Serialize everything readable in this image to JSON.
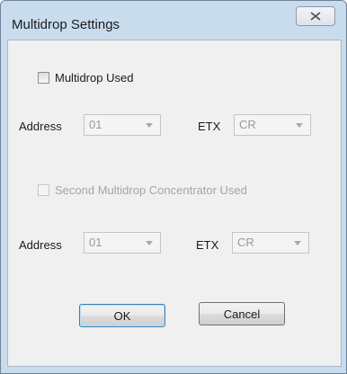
{
  "window": {
    "title": "Multidrop Settings"
  },
  "group1": {
    "checkbox_label": "Multidrop Used",
    "checked": false,
    "address_label": "Address",
    "address_value": "01",
    "etx_label": "ETX",
    "etx_value": "CR"
  },
  "group2": {
    "checkbox_label": "Second Multidrop Concentrator Used",
    "checked": false,
    "address_label": "Address",
    "address_value": "01",
    "etx_label": "ETX",
    "etx_value": "CR"
  },
  "buttons": {
    "ok_label": "OK",
    "cancel_label": "Cancel"
  }
}
